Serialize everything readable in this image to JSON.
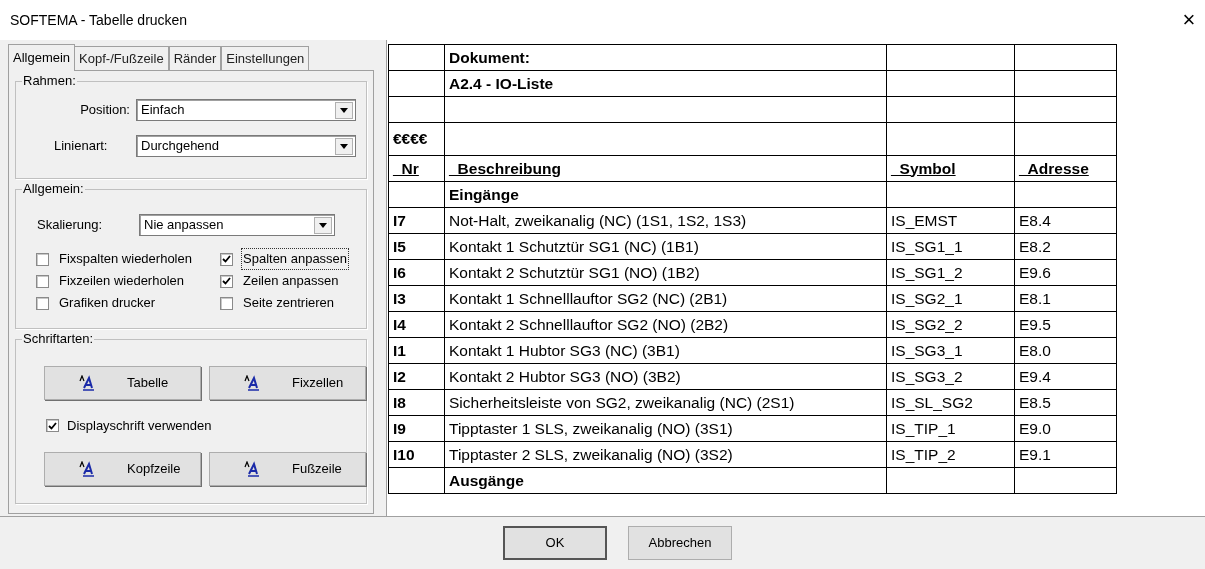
{
  "window": {
    "title": "SOFTEMA - Tabelle drucken",
    "close": "×"
  },
  "tabs": [
    {
      "label": "Allgemein",
      "selected": true
    },
    {
      "label": "Kopf-/Fußzeile",
      "selected": false
    },
    {
      "label": "Ränder",
      "selected": false
    },
    {
      "label": "Einstellungen",
      "selected": false
    }
  ],
  "frame_group": {
    "title": "Rahmen:",
    "position": {
      "label": "Position:",
      "value": "Einfach"
    },
    "line_style": {
      "label": "Linienart:",
      "value": "Durchgehend"
    }
  },
  "general_group": {
    "title": "Allgemein:",
    "scaling": {
      "label": "Skalierung:",
      "value": "Nie anpassen"
    },
    "checkboxes": [
      {
        "label": "Fixspalten wiederholen",
        "checked": false,
        "focused": false
      },
      {
        "label": "Spalten anpassen",
        "checked": true,
        "focused": true
      },
      {
        "label": "Fixzeilen wiederholen",
        "checked": false,
        "focused": false
      },
      {
        "label": "Zeilen anpassen",
        "checked": true,
        "focused": false
      },
      {
        "label": "Grafiken drucker",
        "checked": false,
        "focused": false
      },
      {
        "label": "Seite zentrieren",
        "checked": false,
        "focused": false
      }
    ]
  },
  "fonts_group": {
    "title": "Schriftarten:",
    "buttons_top": [
      "Tabelle",
      "Fixzellen"
    ],
    "display_font": {
      "label": "Displayschrift verwenden",
      "checked": true
    },
    "buttons_bottom": [
      "Kopfzeile",
      "Fußzeile"
    ]
  },
  "table": {
    "rows": [
      {
        "kind": "title",
        "description": "Dokument:"
      },
      {
        "kind": "title",
        "description": "A2.4 - IO-Liste"
      },
      {
        "kind": "blank"
      },
      {
        "kind": "tall",
        "nr": "€€€€"
      },
      {
        "kind": "header",
        "nr": "_Nr",
        "description": "_Beschreibung",
        "symbol": "_Symbol",
        "address": "_Adresse"
      },
      {
        "kind": "title",
        "description": "Eingänge"
      },
      {
        "kind": "item",
        "nr": "I7",
        "description": "Not-Halt, zweikanalig (NC) (1S1, 1S2, 1S3)",
        "symbol": "IS_EMST",
        "address": "E8.4"
      },
      {
        "kind": "item",
        "nr": "I5",
        "description": "Kontakt 1 Schutztür SG1 (NC) (1B1)",
        "symbol": "IS_SG1_1",
        "address": "E8.2"
      },
      {
        "kind": "item",
        "nr": "I6",
        "description": "Kontakt 2 Schutztür SG1 (NO) (1B2)",
        "symbol": "IS_SG1_2",
        "address": "E9.6"
      },
      {
        "kind": "item",
        "nr": "I3",
        "description": "Kontakt 1 Schnelllauftor SG2 (NC) (2B1)",
        "symbol": "IS_SG2_1",
        "address": "E8.1"
      },
      {
        "kind": "item",
        "nr": "I4",
        "description": "Kontakt 2 Schnelllauftor SG2 (NO) (2B2)",
        "symbol": "IS_SG2_2",
        "address": "E9.5"
      },
      {
        "kind": "item",
        "nr": "I1",
        "description": "Kontakt 1 Hubtor SG3 (NC) (3B1)",
        "symbol": "IS_SG3_1",
        "address": "E8.0"
      },
      {
        "kind": "item",
        "nr": "I2",
        "description": "Kontakt 2 Hubtor SG3 (NO) (3B2)",
        "symbol": "IS_SG3_2",
        "address": "E9.4"
      },
      {
        "kind": "item",
        "nr": "I8",
        "description": "Sicherheitsleiste von SG2, zweikanalig (NC) (2S1)",
        "symbol": "IS_SL_SG2",
        "address": "E8.5"
      },
      {
        "kind": "item",
        "nr": "I9",
        "description": "Tipptaster 1 SLS, zweikanalig (NO) (3S1)",
        "symbol": "IS_TIP_1",
        "address": "E9.0"
      },
      {
        "kind": "item",
        "nr": "I10",
        "description": "Tipptaster 2 SLS, zweikanalig (NO) (3S2)",
        "symbol": "IS_TIP_2",
        "address": "E9.1"
      },
      {
        "kind": "title",
        "description": "Ausgänge"
      }
    ]
  },
  "buttons": [
    "OK",
    "Abbrechen"
  ]
}
